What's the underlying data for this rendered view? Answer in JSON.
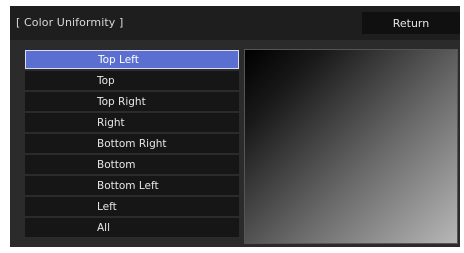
{
  "header": {
    "title": "[ Color Uniformity ]",
    "return_label": "Return"
  },
  "menu": {
    "selected_index": 0,
    "items": [
      {
        "label": "Top Left"
      },
      {
        "label": "Top"
      },
      {
        "label": "Top Right"
      },
      {
        "label": "Right"
      },
      {
        "label": "Bottom Right"
      },
      {
        "label": "Bottom"
      },
      {
        "label": "Bottom Left"
      },
      {
        "label": "Left"
      },
      {
        "label": "All"
      }
    ]
  },
  "colors": {
    "selected": "#5a6fcf",
    "panel": "#2b2b2b",
    "item": "#161616"
  }
}
